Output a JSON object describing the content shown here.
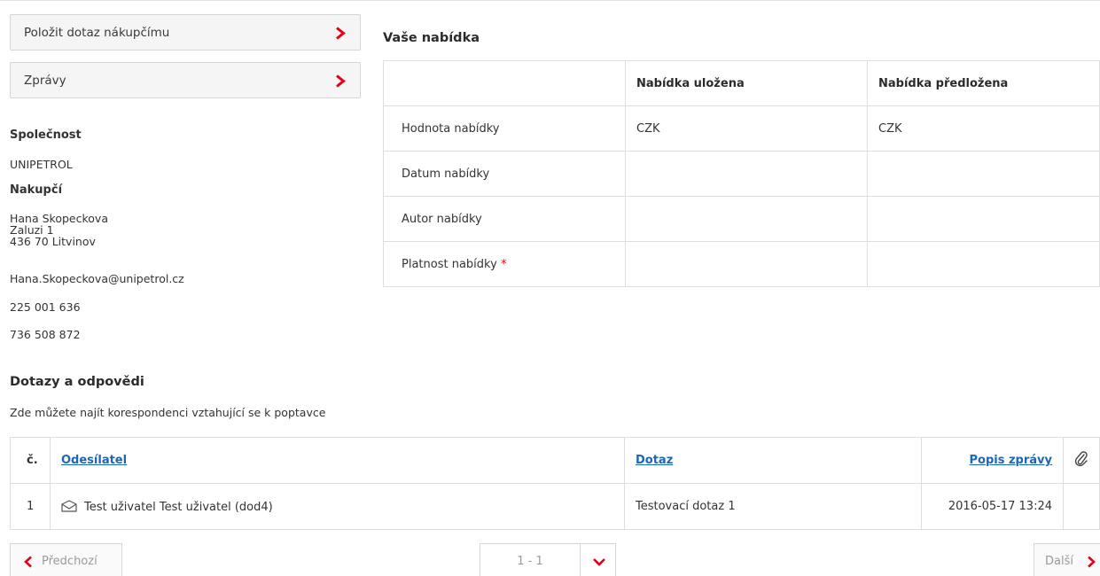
{
  "side": {
    "ask_buyer_label": "Položit dotaz nákupčímu",
    "messages_label": "Zprávy",
    "company_heading": "Společnost",
    "company_name": "UNIPETROL",
    "buyer_heading": "Nakupčí",
    "buyer_name": "Hana Skopeckova",
    "buyer_street": "Zaluzi 1",
    "buyer_city": "436 70 Litvinov",
    "buyer_email": "Hana.Skopeckova@unipetrol.cz",
    "phone1": "225 001 636",
    "phone2": "736 508 872"
  },
  "offer": {
    "heading": "Vaše nabídka",
    "col_saved": "Nabídka uložena",
    "col_submitted": "Nabídka předložena",
    "rows": [
      {
        "label": "Hodnota nabídky",
        "saved": "CZK",
        "submitted": "CZK"
      },
      {
        "label": "Datum nabídky",
        "saved": "",
        "submitted": ""
      },
      {
        "label": "Autor nabídky",
        "saved": "",
        "submitted": ""
      },
      {
        "label": "Platnost nabídky",
        "saved": "",
        "submitted": "",
        "required_mark": "*"
      }
    ]
  },
  "qa": {
    "heading": "Dotazy a odpovědi",
    "description": "Zde můžete najít korespondenci vztahující se k poptavce",
    "col_num": "č.",
    "col_sender": "Odesílatel",
    "col_question": "Dotaz",
    "col_desc": "Popis zprávy",
    "attachment_icon": "paperclip-icon",
    "rows": [
      {
        "num": "1",
        "sender": "Test uživatel Test uživatel (dod4)",
        "question": "Testovací dotaz 1",
        "date": "2016-05-17 13:24",
        "icon": "envelope-icon"
      }
    ]
  },
  "pager": {
    "prev_label": "Předchozí",
    "range": "1 - 1",
    "next_label": "Další"
  },
  "colors": {
    "accent_red": "#e2001a",
    "link_blue": "#1d65b8"
  }
}
